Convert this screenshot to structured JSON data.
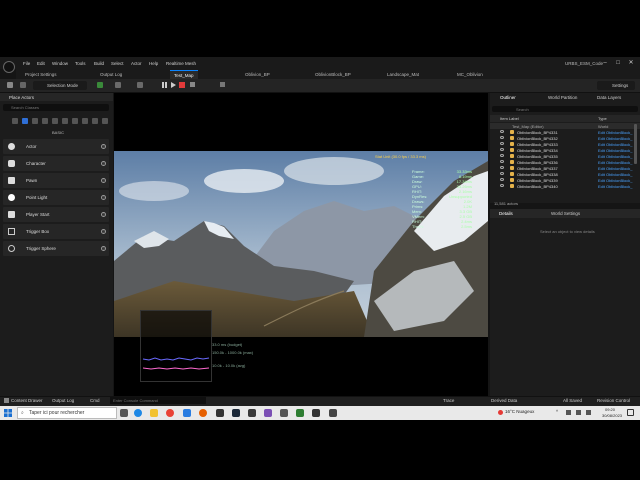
{
  "app": {
    "project_label": "URBS_ESM_Code",
    "menu": [
      "File",
      "Edit",
      "Window",
      "Tools",
      "Build",
      "Select",
      "Actor",
      "Help",
      "Realtime Mesh"
    ],
    "window_controls": [
      "–",
      "□",
      "✕"
    ]
  },
  "tabs": {
    "left_tabs": [
      "Project Settings",
      "Output Log"
    ],
    "main": [
      "Test_Map",
      "Oblivion_BP",
      "OblivionBlock_BP",
      "Landscape_Mat",
      "MC_Oblivion"
    ],
    "active": "Test_Map"
  },
  "toolbar": {
    "save_label": "",
    "selection_mode": "Selection Mode",
    "settings_label": "Settings"
  },
  "place_actors": {
    "title": "Place Actors",
    "search_placeholder": "Search Classes",
    "section_label": "BASIC",
    "items": [
      {
        "label": "Actor"
      },
      {
        "label": "Character"
      },
      {
        "label": "Pawn"
      },
      {
        "label": "Point Light"
      },
      {
        "label": "Player Start"
      },
      {
        "label": "Trigger Box"
      },
      {
        "label": "Trigger Sphere"
      }
    ]
  },
  "viewport": {
    "stat_header": "Stat Unit (30.0 fps / 33.3 ms)",
    "stats": [
      {
        "label": "Frame:",
        "value": "33.33ms"
      },
      {
        "label": "Game:",
        "value": "8.19ms"
      },
      {
        "label": "Draw:",
        "value": "17.34ms"
      },
      {
        "label": "GPU:",
        "value": "33.26ms"
      },
      {
        "label": "RHIT:",
        "value": "2.16ms"
      },
      {
        "label": "DynRes:",
        "value": "Unsupported"
      },
      {
        "label": "Draws:",
        "value": "2.0K"
      },
      {
        "label": "Prims:",
        "value": "1.2M"
      },
      {
        "label": "Mem:",
        "value": "3.3 GB"
      },
      {
        "label": "VMem:",
        "value": "2.5 GB"
      },
      {
        "label": "RHIT:",
        "value": "2.4ms"
      },
      {
        "label": "ThrdN:",
        "value": "2.5ms"
      }
    ],
    "graph_labels": [
      "33.0 ms (budget)",
      "150.0k - 1000.0k (max)",
      "10.0k - 10.0k (avg)"
    ]
  },
  "outliner": {
    "tabs": [
      "Outliner",
      "World Partition",
      "Data Layers"
    ],
    "search_placeholder": "Search",
    "col_label": "Item Label",
    "col_type": "Type",
    "rows": [
      {
        "label": "Test_Map (Editor)",
        "type": "World"
      },
      {
        "label": "OblivionBlock_BP4331",
        "type": "Edit OblivionBlock_"
      },
      {
        "label": "OblivionBlock_BP4332",
        "type": "Edit OblivionBlock_"
      },
      {
        "label": "OblivionBlock_BP4333",
        "type": "Edit OblivionBlock_"
      },
      {
        "label": "OblivionBlock_BP4334",
        "type": "Edit OblivionBlock_"
      },
      {
        "label": "OblivionBlock_BP4335",
        "type": "Edit OblivionBlock_"
      },
      {
        "label": "OblivionBlock_BP4336",
        "type": "Edit OblivionBlock_"
      },
      {
        "label": "OblivionBlock_BP4337",
        "type": "Edit OblivionBlock_"
      },
      {
        "label": "OblivionBlock_BP4338",
        "type": "Edit OblivionBlock_"
      },
      {
        "label": "OblivionBlock_BP4339",
        "type": "Edit OblivionBlock_"
      },
      {
        "label": "OblivionBlock_BP4340",
        "type": "Edit OblivionBlock_"
      }
    ],
    "count_label": "11,581 actors"
  },
  "details": {
    "tabs": [
      "Details",
      "World Settings"
    ],
    "empty_msg": "Select an object to view details"
  },
  "statusbar": {
    "content_drawer": "Content Drawer",
    "output_log": "Output Log",
    "cmd": "Cmd",
    "cmd_placeholder": "Enter Console Command",
    "trace": "Trace",
    "derived_data": "Derived Data",
    "all_saved": "All Saved",
    "revision": "Revision Control"
  },
  "taskbar": {
    "search_text": "Taper ici pour rechercher",
    "weather": "16°C Nuageux",
    "time": "09:20",
    "date": "30/08/2023"
  }
}
